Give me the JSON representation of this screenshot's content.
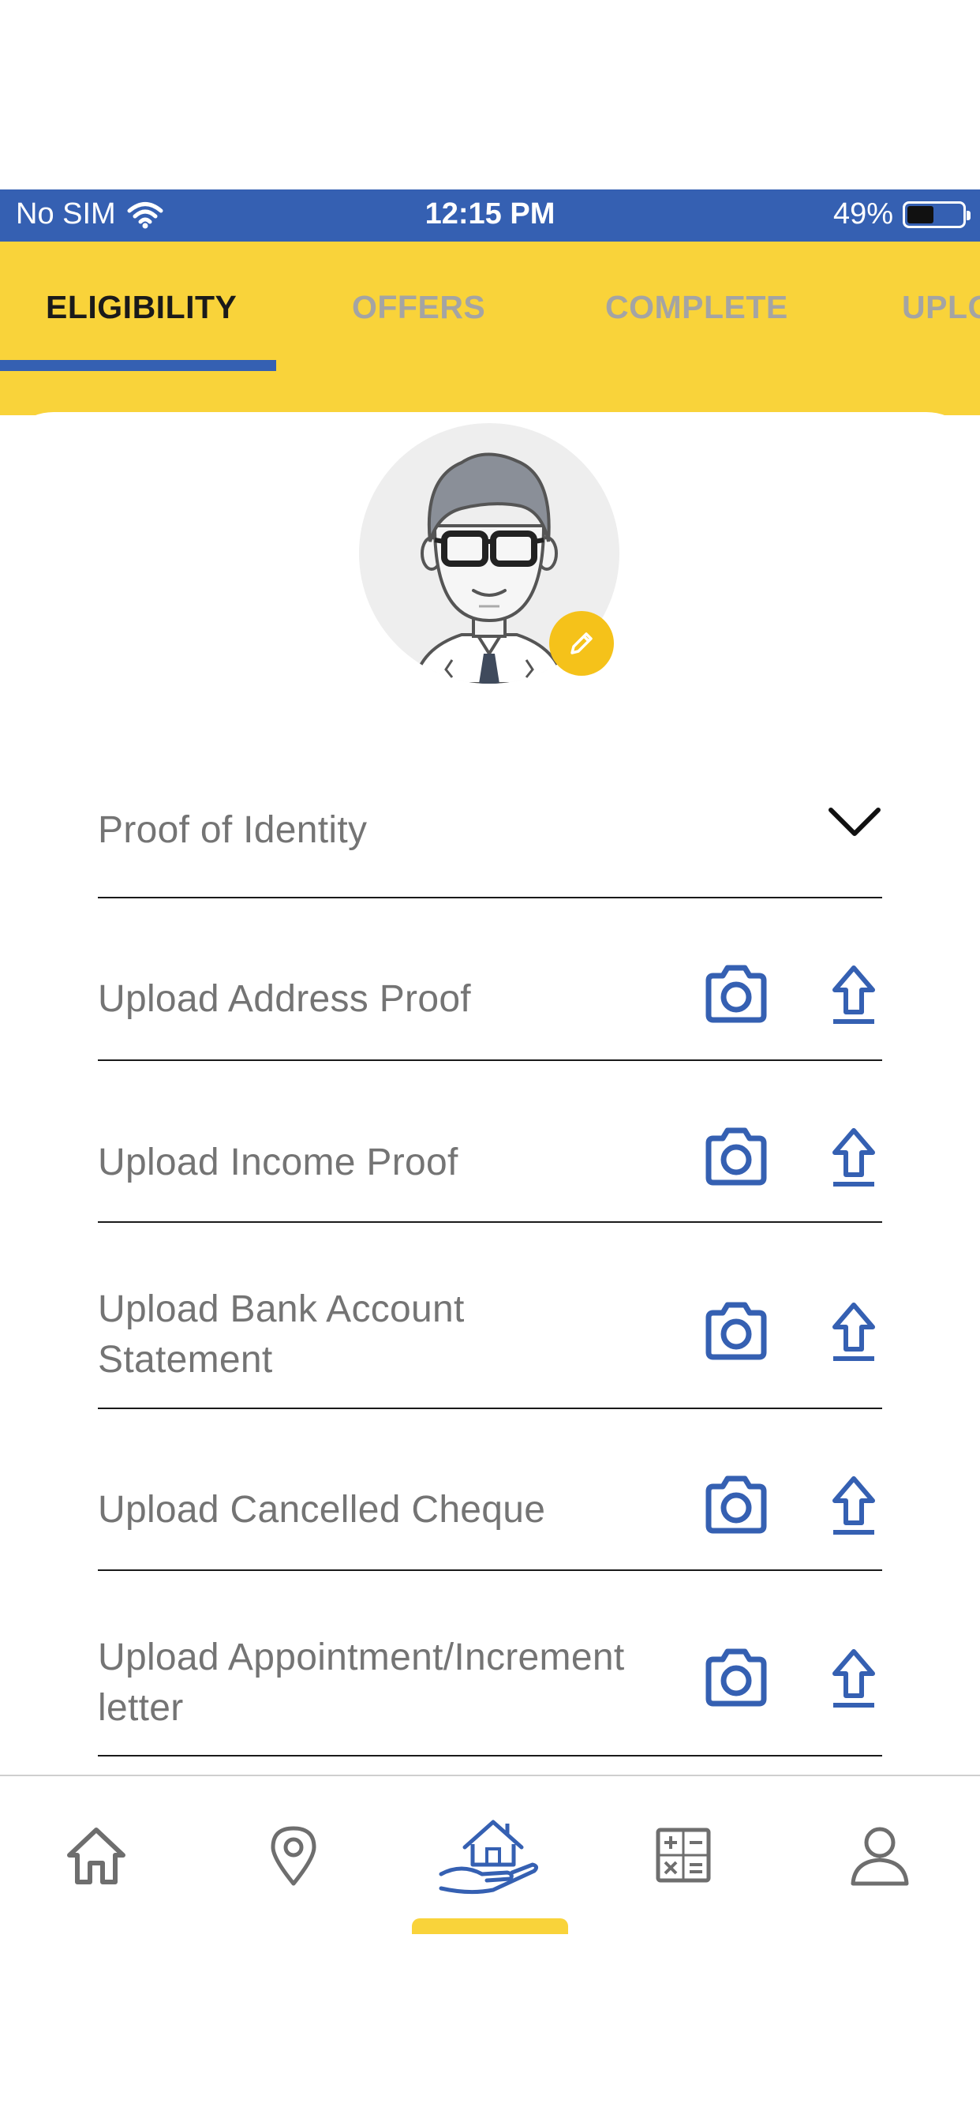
{
  "status_bar": {
    "carrier": "No SIM",
    "time": "12:15 PM",
    "battery_percent": "49%",
    "battery_level": 0.49
  },
  "tabs": [
    {
      "label": "ELIGIBILITY",
      "active": true
    },
    {
      "label": "OFFERS",
      "active": false
    },
    {
      "label": "COMPLETE",
      "active": false
    },
    {
      "label": "UPLO",
      "active": false
    }
  ],
  "profile": {
    "avatar_icon": "person-avatar-icon",
    "edit_icon": "pencil-icon"
  },
  "documents": {
    "identity_dropdown": "Proof of Identity",
    "items": [
      {
        "label": "Upload Address Proof"
      },
      {
        "label": "Upload Income Proof"
      },
      {
        "label": "Upload Bank Account Statement"
      },
      {
        "label": "Upload Cancelled Cheque"
      },
      {
        "label": "Upload Appointment/Increment letter"
      }
    ]
  },
  "bottom_nav": {
    "items": [
      "home-icon",
      "location-pin-icon",
      "home-loan-icon",
      "calculator-icon",
      "profile-icon"
    ],
    "active_index": 2
  },
  "colors": {
    "primary_blue": "#3560b2",
    "accent_yellow": "#f9d33a",
    "edit_yellow": "#f5c21a",
    "label_gray": "#747474"
  }
}
